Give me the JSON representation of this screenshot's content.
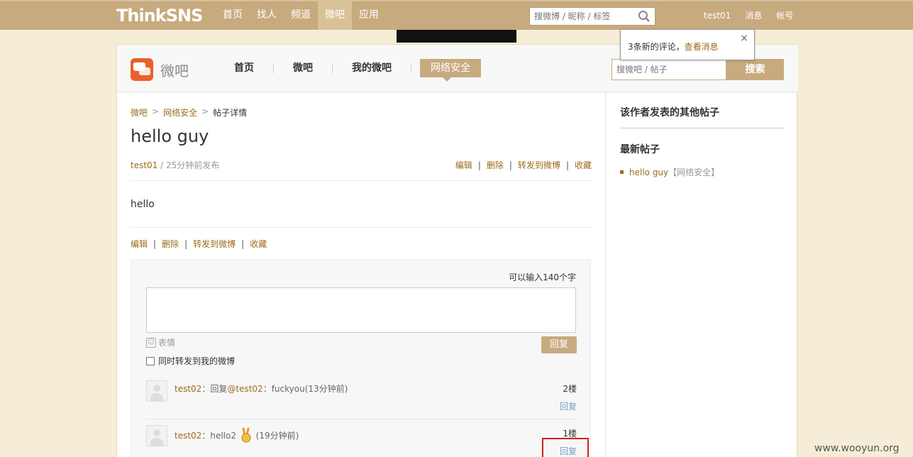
{
  "topbar": {
    "logo": "ThinkSNS",
    "nav": [
      "首页",
      "找人",
      "频道",
      "微吧",
      "应用"
    ],
    "active_nav": "微吧",
    "search_placeholder": "搜微博 / 昵称 / 标签",
    "user": "test01",
    "messages": "消息",
    "account": "帐号"
  },
  "notification": {
    "text": "3条新的评论，",
    "link": "查看消息",
    "close": "×"
  },
  "subheader": {
    "logo_text": "微吧",
    "nav": [
      "首页",
      "微吧",
      "我的微吧",
      "网络安全"
    ],
    "search_placeholder": "搜微吧 / 帖子",
    "search_button": "搜索"
  },
  "breadcrumb": {
    "items": [
      "微吧",
      "网络安全",
      "帖子详情"
    ],
    "separator": ">"
  },
  "post": {
    "title": "hello guy",
    "author": "test01",
    "time": " / 25分钟前发布",
    "content": "hello",
    "actions": [
      "编辑",
      "删除",
      "转发到微博",
      "收藏"
    ],
    "action_separator": "|"
  },
  "reply_box": {
    "char_count": "可以输入140个字",
    "emoji_label": "表情",
    "reply_button": "回复",
    "repost_label": "同时转发到我的微博"
  },
  "comments": [
    {
      "author": "test02",
      "colon": "：",
      "prefix": "回复",
      "at": "@test02",
      "at_colon": "：",
      "text": "fuckyou(13分钟前)",
      "floor": "2楼",
      "reply": "回复"
    },
    {
      "author": "test02",
      "colon": "：",
      "text": "hello2",
      "time": "(19分钟前)",
      "floor": "1楼",
      "reply": "回复"
    }
  ],
  "sidebar": {
    "heading_other": "该作者发表的其他帖子",
    "heading_latest": "最新帖子",
    "latest": [
      {
        "title": "hello guy",
        "tag": "【网络安全】"
      }
    ]
  },
  "watermark": "www.wooyun.org",
  "colors": {
    "topbar": "#c8aa7f",
    "link": "#9b6b1a",
    "page_bg": "#f5edd6",
    "highlight": "#d42020"
  }
}
